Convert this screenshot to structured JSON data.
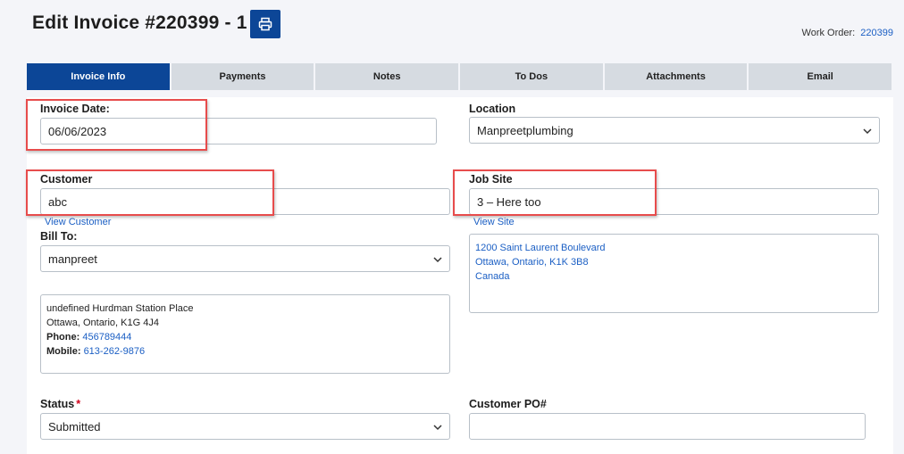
{
  "header": {
    "title": "Edit Invoice #220399 - 1",
    "print_icon": "printer-icon",
    "work_order_label": "Work Order:",
    "work_order_value": "220399"
  },
  "tabs": [
    {
      "label": "Invoice Info",
      "active": true
    },
    {
      "label": "Payments",
      "active": false
    },
    {
      "label": "Notes",
      "active": false
    },
    {
      "label": "To Dos",
      "active": false
    },
    {
      "label": "Attachments",
      "active": false
    },
    {
      "label": "Email",
      "active": false
    }
  ],
  "form": {
    "invoice_date": {
      "label": "Invoice Date:",
      "value": "06/06/2023"
    },
    "location": {
      "label": "Location",
      "value": "Manpreetplumbing"
    },
    "customer": {
      "label": "Customer",
      "value": "abc",
      "link": "View Customer"
    },
    "job_site": {
      "label": "Job Site",
      "value": "3 – Here too",
      "link": "View Site"
    },
    "bill_to": {
      "label": "Bill To:",
      "value": "manpreet"
    },
    "bill_address": {
      "line1": "undefined Hurdman Station Place",
      "line2": "Ottawa, Ontario, K1G 4J4",
      "phone_label": "Phone:",
      "phone": "456789444",
      "mobile_label": "Mobile:",
      "mobile": "613-262-9876"
    },
    "site_address": {
      "line1": "1200 Saint Laurent Boulevard",
      "line2": "Ottawa, Ontario, K1K 3B8",
      "line3": "Canada"
    },
    "status": {
      "label": "Status",
      "required_mark": "*",
      "value": "Submitted"
    },
    "customer_po": {
      "label": "Customer PO#",
      "value": ""
    }
  },
  "colors": {
    "primary": "#0c4697",
    "link": "#1b5fc4",
    "tab_inactive": "#d6dbe1",
    "highlight": "#e74c4c",
    "required": "#d0021b"
  }
}
